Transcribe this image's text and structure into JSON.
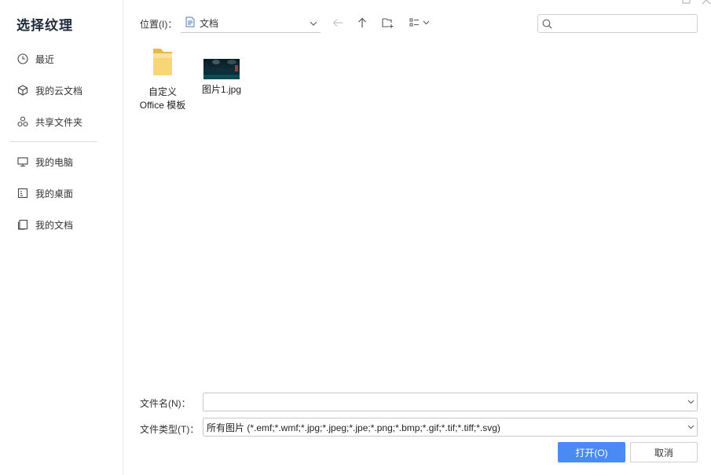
{
  "dialog": {
    "title": "选择纹理"
  },
  "sidebar": {
    "items": [
      {
        "label": "最近",
        "icon": "clock-icon"
      },
      {
        "label": "我的云文档",
        "icon": "cloud-cube-icon"
      },
      {
        "label": "共享文件夹",
        "icon": "share-icon"
      },
      {
        "label": "我的电脑",
        "icon": "monitor-icon"
      },
      {
        "label": "我的桌面",
        "icon": "desktop-icon"
      },
      {
        "label": "我的文档",
        "icon": "documents-icon"
      }
    ]
  },
  "toolbar": {
    "location_label": "位置(I)：",
    "location_value": "文档",
    "search_placeholder": ""
  },
  "files": [
    {
      "name_line1": "自定义",
      "name_line2": "Office 模板",
      "type": "folder"
    },
    {
      "name_line1": "图片1.jpg",
      "name_line2": "",
      "type": "image"
    }
  ],
  "bottom": {
    "filename_label": "文件名(N)：",
    "filename_value": "",
    "filetype_label": "文件类型(T)：",
    "filetype_value": "所有图片 (*.emf;*.wmf;*.jpg;*.jpeg;*.jpe;*.png;*.bmp;*.gif;*.tif;*.tiff;*.svg)",
    "open_label": "打开(O)",
    "cancel_label": "取消"
  },
  "colors": {
    "accent": "#4a8af4",
    "folder": "#f5cd5b"
  }
}
